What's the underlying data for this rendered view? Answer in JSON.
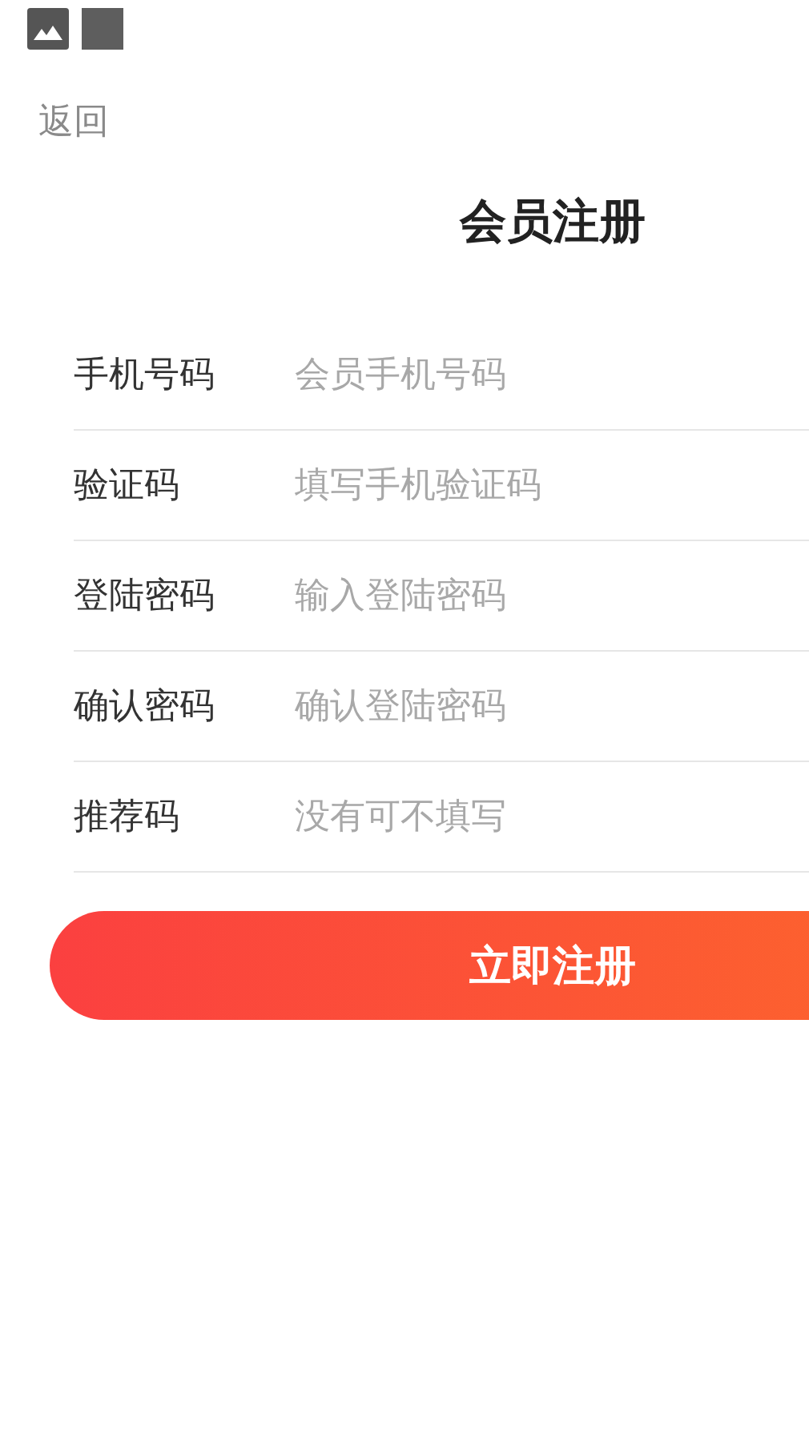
{
  "back": "返回",
  "title": "会员注册",
  "fields": [
    {
      "label": "手机号码",
      "placeholder": "会员手机号码"
    },
    {
      "label": "验证码",
      "placeholder": "填写手机验证码"
    },
    {
      "label": "登陆密码",
      "placeholder": "输入登陆密码"
    },
    {
      "label": "确认密码",
      "placeholder": "确认登陆密码"
    },
    {
      "label": "推荐码",
      "placeholder": "没有可不填写"
    }
  ],
  "submit": "立即注册"
}
